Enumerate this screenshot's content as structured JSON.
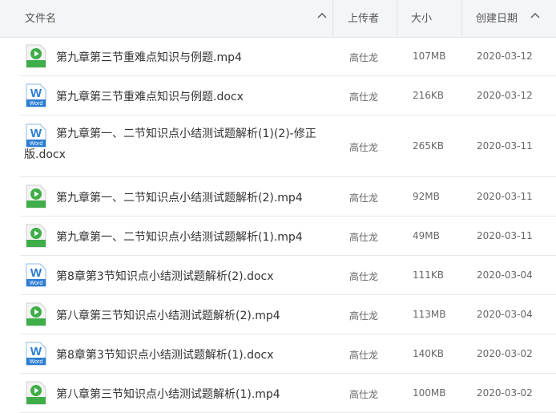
{
  "header": {
    "name": "文件名",
    "uploader": "上传者",
    "size": "大小",
    "created": "创建日期"
  },
  "rows": [
    {
      "type": "mp4",
      "name": "第九章第三节重难点知识与例题.mp4",
      "uploader": "高仕龙",
      "size": "107MB",
      "date": "2020-03-12"
    },
    {
      "type": "docx",
      "name": "第九章第三节重难点知识与例题.docx",
      "uploader": "高仕龙",
      "size": "216KB",
      "date": "2020-03-12"
    },
    {
      "type": "docx",
      "name": "第九章第一、二节知识点小结测试题解析(1)(2)-修正版.docx",
      "uploader": "高仕龙",
      "size": "265KB",
      "date": "2020-03-11"
    },
    {
      "type": "mp4",
      "name": "第九章第一、二节知识点小结测试题解析(2).mp4",
      "uploader": "高仕龙",
      "size": "92MB",
      "date": "2020-03-11"
    },
    {
      "type": "mp4",
      "name": "第九章第一、二节知识点小结测试题解析(1).mp4",
      "uploader": "高仕龙",
      "size": "49MB",
      "date": "2020-03-11"
    },
    {
      "type": "docx",
      "name": "第8章第3节知识点小结测试题解析(2).docx",
      "uploader": "高仕龙",
      "size": "111KB",
      "date": "2020-03-04"
    },
    {
      "type": "mp4",
      "name": "第八章第三节知识点小结测试题解析(2).mp4",
      "uploader": "高仕龙",
      "size": "113MB",
      "date": "2020-03-04"
    },
    {
      "type": "docx",
      "name": "第8章第3节知识点小结测试题解析(1).docx",
      "uploader": "高仕龙",
      "size": "140KB",
      "date": "2020-03-02"
    },
    {
      "type": "mp4",
      "name": "第八章第三节知识点小结测试题解析(1).mp4",
      "uploader": "高仕龙",
      "size": "100MB",
      "date": "2020-03-02"
    }
  ],
  "icons": {
    "mp4": "video-file-icon",
    "docx": "word-file-icon",
    "word_label": "Word"
  },
  "colors": {
    "video_green": "#3fae49",
    "word_blue": "#2b7cd3"
  }
}
